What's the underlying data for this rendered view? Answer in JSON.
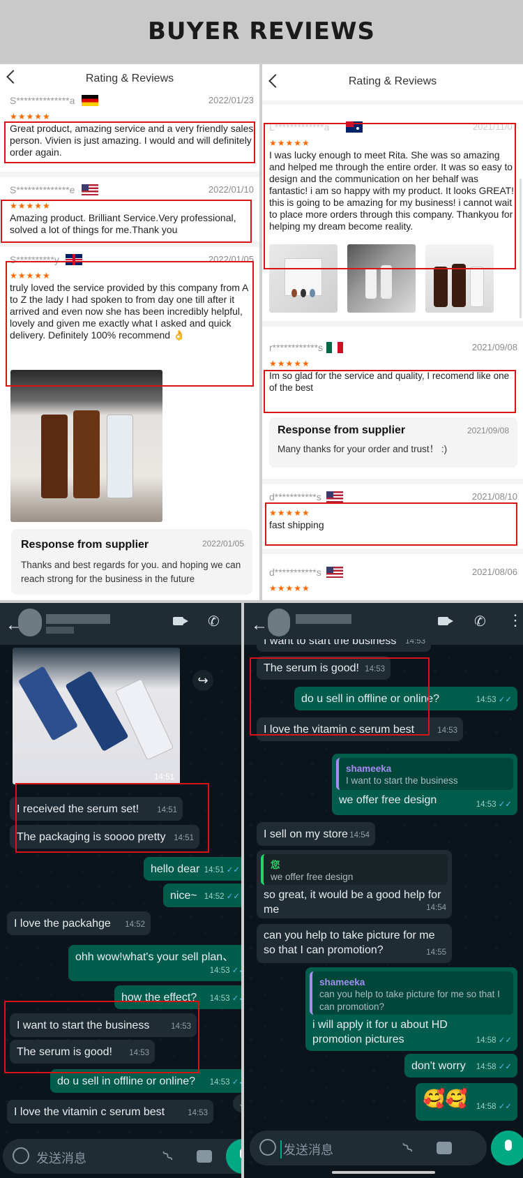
{
  "banner": {
    "title": "BUYER REVIEWS"
  },
  "left_reviews": {
    "header_title": "Rating & Reviews",
    "stars": "★★★★★",
    "reviews": [
      {
        "name": "S**************a",
        "flag": "Germany",
        "date": "2022/01/23",
        "text": "Great product, amazing service and a very friendly sales person. Vivien is just amazing. I would and will definitely order again."
      },
      {
        "name": "S**************e",
        "flag": "USA",
        "date": "2022/01/10",
        "text": "Amazing product. Brilliant Service.Very professional, solved a lot of things for me.Thank you"
      },
      {
        "name": "S**********y",
        "flag": "UK",
        "date": "2022/01/05",
        "text": "truly loved the service provided by this company from A to Z the lady I had spoken to from day one till after it arrived and even now she has been incredibly helpful, lovely and given me exactly what I asked and quick delivery. Definitely 100% recommend 👌"
      }
    ],
    "supplier": {
      "title": "Response from supplier",
      "date": "2022/01/05",
      "text": "Thanks and best regards for you. and hoping we can reach strong for the business in the future"
    }
  },
  "right_reviews": {
    "header_title": "Rating & Reviews",
    "stars": "★★★★★",
    "reviews": [
      {
        "name": "L*************a",
        "flag": "Australia",
        "date": "2021/11/07",
        "text": "I was lucky enough to meet Rita. She was so amazing and helped me through the entire order. It was so easy to design and the communication on her behalf was fantastic! i am so happy with my product. It looks GREAT! this is going to be amazing for my business! i cannot wait to place more orders through this company. Thankyou for helping my dream become reality."
      },
      {
        "name": "r************s",
        "flag": "Mexico",
        "date": "2021/09/08",
        "text": "Im so glad for the service and quality, I recomend like one of the best"
      },
      {
        "name": "d***********s",
        "flag": "USA",
        "date": "2021/08/10",
        "text": "fast shipping"
      },
      {
        "name": "d***********s",
        "flag": "USA",
        "date": "2021/08/06",
        "text": ""
      }
    ],
    "supplier": {
      "title": "Response from supplier",
      "date": "2021/09/08",
      "text": "Many thanks for your order and trust！ :)"
    }
  },
  "left_chat": {
    "photo_time": "14:51",
    "messages": [
      {
        "dir": "in",
        "text": "I received the serum set!",
        "time": "14:51"
      },
      {
        "dir": "in",
        "text": "The packaging is soooo pretty",
        "time": "14:51"
      },
      {
        "dir": "out",
        "text": "hello dear",
        "time": "14:51"
      },
      {
        "dir": "out",
        "text": "nice~",
        "time": "14:52"
      },
      {
        "dir": "in",
        "text": "I love the packahge",
        "time": "14:52"
      },
      {
        "dir": "out",
        "text": "ohh wow!what's your sell plan、",
        "time": "14:53"
      },
      {
        "dir": "out",
        "text": "how the effect?",
        "time": "14:53"
      },
      {
        "dir": "in",
        "text": "I want to start the business",
        "time": "14:53"
      },
      {
        "dir": "in",
        "text": "The serum is good!",
        "time": "14:53"
      },
      {
        "dir": "out",
        "text": "do u sell in offline or online?",
        "time": "14:53"
      },
      {
        "dir": "in",
        "text": "I love the vitamin c serum best",
        "time": "14:53"
      }
    ],
    "input_placeholder": "发送消息"
  },
  "right_chat": {
    "messages": [
      {
        "dir": "in",
        "text": "I want to start the business",
        "time": "14:53"
      },
      {
        "dir": "in",
        "text": "The serum is good!",
        "time": "14:53"
      },
      {
        "dir": "out",
        "text": "do u sell in offline or online?",
        "time": "14:53"
      },
      {
        "dir": "in",
        "text": "I love the vitamin c serum best",
        "time": "14:53"
      },
      {
        "dir": "out",
        "quote_author": "shameeka",
        "quote": "I want to start the business",
        "text": "we offer free design",
        "time": "14:53"
      },
      {
        "dir": "in",
        "text": "I sell on my store",
        "time": "14:54"
      },
      {
        "dir": "in",
        "quote_author": "您",
        "quote": "we offer free design",
        "text": "so great, it would be a good help for me",
        "time": "14:54"
      },
      {
        "dir": "in",
        "text": "can you help to take picture for me so that I can promotion?",
        "time": "14:55"
      },
      {
        "dir": "out",
        "quote_author": "shameeka",
        "quote": "can you help to take picture for me so that I can promotion?",
        "text": "i will apply it for u about HD promotion pictures",
        "time": "14:58"
      },
      {
        "dir": "out",
        "text": "don't worry",
        "time": "14:58"
      },
      {
        "dir": "out",
        "text": "🥰🥰",
        "time": "14:58"
      }
    ],
    "input_placeholder": "发送消息"
  },
  "colors": {
    "star": "#ff6a00",
    "highlight_box": "#d81414",
    "wa_out": "#005c4b",
    "wa_in": "#202c33",
    "wa_bg": "#0b141a",
    "wa_header": "#1f2c33",
    "wa_green": "#00a884"
  },
  "icons": [
    "back-icon",
    "video-call-icon",
    "phone-icon",
    "menu-dots-icon",
    "forward-icon",
    "emoji-icon",
    "attach-icon",
    "camera-icon",
    "mic-icon",
    "scroll-down-icon",
    "read-ticks-icon"
  ]
}
